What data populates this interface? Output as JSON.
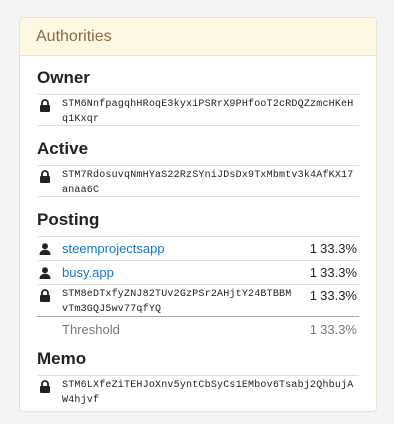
{
  "panel": {
    "title": "Authorities"
  },
  "owner": {
    "title": "Owner",
    "key": "STM6NnfpagqhHRoqE3kyxiPSRrX9PHfooT2cRDQZzmcHKeHq1Kxqr"
  },
  "active": {
    "title": "Active",
    "key": "STM7RdosuvqNmHYaS22RzSYniJDsDx9TxMbmtv3k4AfKX17anaa6C"
  },
  "posting": {
    "title": "Posting",
    "accounts": [
      {
        "name": "steemprojectsapp",
        "weight": "1",
        "percent": "33.3%"
      },
      {
        "name": "busy.app",
        "weight": "1",
        "percent": "33.3%"
      }
    ],
    "key": {
      "value": "STM8eDTxfyZNJ82TUv2GzPSr2AHjtY24BTBBMvTm3GQJ5wv77qfYQ",
      "weight": "1",
      "percent": "33.3%"
    },
    "threshold": {
      "label": "Threshold",
      "weight": "1",
      "percent": "33.3%"
    }
  },
  "memo": {
    "title": "Memo",
    "key": "STM6LXfeZiTEHJoXnv5yntCbSyCs1EMbov6Tsabj2QhbujAW4hjvf"
  },
  "icons": {
    "key": "lock-icon",
    "account": "user-icon"
  },
  "colors": {
    "heading_bg": "#fcf8e3",
    "heading_text": "#8a6d3b",
    "link": "#1a73c9"
  }
}
